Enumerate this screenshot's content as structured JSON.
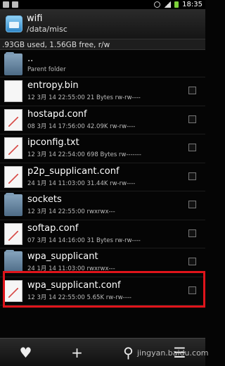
{
  "status_bar": {
    "time": "18:35",
    "icons": [
      "notification-icon",
      "image-icon",
      "alarm-icon",
      "signal-icon",
      "battery-icon"
    ],
    "battery_color": "#7dd13a"
  },
  "header": {
    "title": "wifi",
    "path": "/data/misc",
    "icon": "folder-app-icon"
  },
  "storage_usage": ".93GB used, 1.56GB free, r/w",
  "files": [
    {
      "name": "..",
      "meta": "Parent folder",
      "type": "folder",
      "checkbox": false
    },
    {
      "name": "entropy.bin",
      "meta": "12 3月 14 22:55:00  21 Bytes  rw-rw----",
      "type": "doc",
      "checkbox": true
    },
    {
      "name": "hostapd.conf",
      "meta": "08 3月 14 17:56:00  42.09K  rw-rw----",
      "type": "txt",
      "checkbox": true
    },
    {
      "name": "ipconfig.txt",
      "meta": "12 3月 14 22:54:00  698 Bytes  rw-------",
      "type": "txt",
      "checkbox": true
    },
    {
      "name": "p2p_supplicant.conf",
      "meta": "24 1月 14 11:03:00  31.44K  rw-rw----",
      "type": "txt",
      "checkbox": true
    },
    {
      "name": "sockets",
      "meta": "12 3月 14 22:55:00     rwxrwx---",
      "type": "folder",
      "checkbox": true
    },
    {
      "name": "softap.conf",
      "meta": "07 3月 14 14:16:00  31 Bytes  rw-rw----",
      "type": "txt",
      "checkbox": true
    },
    {
      "name": "wpa_supplicant",
      "meta": "24 1月 14 11:03:00     rwxrwx---",
      "type": "folder",
      "checkbox": true
    },
    {
      "name": "wpa_supplicant.conf",
      "meta": "12 3月 14 22:55:00  5.65K  rw-rw----",
      "type": "txt",
      "checkbox": true
    }
  ],
  "highlight_color": "#e0141b",
  "toolbar": {
    "buttons": [
      {
        "icon": "heart-icon",
        "glyph": "♥"
      },
      {
        "icon": "plus-icon",
        "glyph": "+"
      },
      {
        "icon": "search-icon",
        "glyph": "⚲"
      },
      {
        "icon": "menu-icon",
        "glyph": "☰"
      }
    ]
  },
  "watermark": "jingyan.baidu.com"
}
